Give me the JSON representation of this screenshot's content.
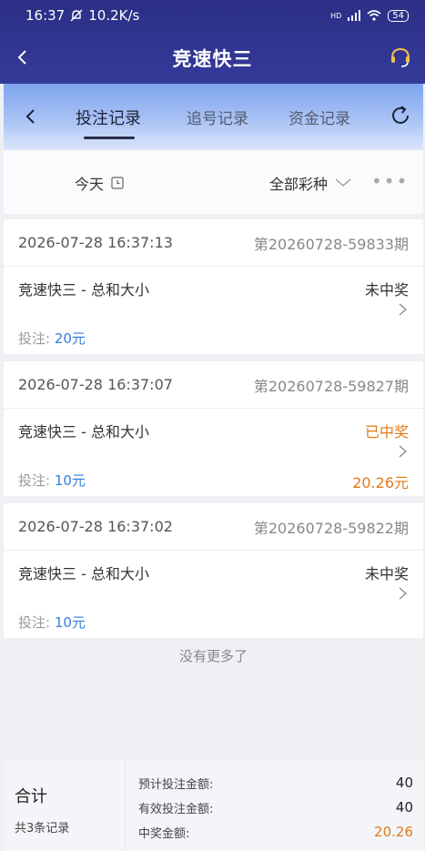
{
  "status_bar": {
    "time": "16:37",
    "net_speed": "10.2K/s",
    "battery": "54",
    "hd": "HD"
  },
  "header": {
    "title": "竞速快三"
  },
  "tabs": [
    {
      "label": "投注记录",
      "active": true
    },
    {
      "label": "追号记录",
      "active": false
    },
    {
      "label": "资金记录",
      "active": false
    }
  ],
  "filter": {
    "date": "今天",
    "lottery": "全部彩种",
    "more": "•••"
  },
  "records": [
    {
      "time": "2026-07-28 16:37:13",
      "issue": "第20260728-59833期",
      "game": "竞速快三 - 总和大小",
      "status": "未中奖",
      "bet_label": "投注: ",
      "bet_amount": "20元",
      "prize": ""
    },
    {
      "time": "2026-07-28 16:37:07",
      "issue": "第20260728-59827期",
      "game": "竞速快三 - 总和大小",
      "status": "已中奖",
      "bet_label": "投注: ",
      "bet_amount": "10元",
      "prize": "20.26元"
    },
    {
      "time": "2026-07-28 16:37:02",
      "issue": "第20260728-59822期",
      "game": "竞速快三 - 总和大小",
      "status": "未中奖",
      "bet_label": "投注: ",
      "bet_amount": "10元",
      "prize": ""
    }
  ],
  "no_more": "没有更多了",
  "summary": {
    "title": "合计",
    "count": "共3条记录",
    "rows": [
      {
        "label": "预计投注金额:",
        "value": "40"
      },
      {
        "label": "有效投注金额:",
        "value": "40"
      },
      {
        "label": "中奖金额:",
        "value": "20.26"
      }
    ]
  },
  "colors": {
    "header_bg": "#2b2f85",
    "win": "#e27a17",
    "bet_amount": "#2f7fdc"
  }
}
